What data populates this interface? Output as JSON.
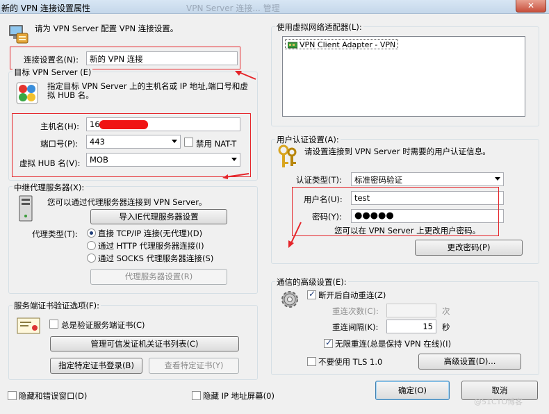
{
  "window": {
    "title": "新的 VPN 连接设置属性",
    "background_title": "VPN Server 连接... 管理",
    "close_label": "✕"
  },
  "header": {
    "intro_text": "请为 VPN Server 配置 VPN 连接设置。"
  },
  "connection": {
    "name_label": "连接设置名(N):",
    "name_value": "新的 VPN 连接"
  },
  "target_server": {
    "group_label": "目标 VPN Server (E)",
    "description": "指定目标 VPN Server 上的主机名或 IP 地址,端口号和虚拟 HUB 名。",
    "host_label": "主机名(H):",
    "host_value": "169",
    "port_label": "端口号(P):",
    "port_value": "443",
    "disable_nat_label": "禁用 NAT-T",
    "hub_label": "虚拟 HUB 名(V):",
    "hub_value": "MOB"
  },
  "proxy": {
    "group_label": "中继代理服务器(X):",
    "description": "您可以通过代理服务器连接到 VPN Server。",
    "import_button": "导入IE代理服务器设置",
    "type_label": "代理类型(T):",
    "options": [
      "直接 TCP/IP 连接(无代理)(D)",
      "通过 HTTP 代理服务器连接(I)",
      "通过 SOCKS 代理服务器连接(S)"
    ],
    "settings_button": "代理服务器设置(R)"
  },
  "cert": {
    "group_label": "服务端证书验证选项(F):",
    "always_verify_label": "总是验证服务端证书(C)",
    "manage_button": "管理可信发证机关证书列表(C)",
    "specify_button": "指定特定证书登录(B)",
    "view_button": "查看特定证书(Y)"
  },
  "footer": {
    "hide_status_label": "隐藏和错误窗口(D)",
    "hide_ip_label": "隐藏 IP 地址屏幕(0)",
    "ok_button": "确定(O)",
    "cancel_button": "取消"
  },
  "adapter": {
    "group_label": "使用虚拟网络适配器(L):",
    "items": [
      "VPN Client Adapter - VPN"
    ]
  },
  "auth": {
    "group_label": "用户认证设置(A):",
    "description": "请设置连接到 VPN Server 时需要的用户认证信息。",
    "type_label": "认证类型(T):",
    "type_value": "标准密码验证",
    "username_label": "用户名(U):",
    "username_value": "test",
    "password_label": "密码(Y):",
    "password_value": "●●●●●",
    "change_hint": "您可以在 VPN Server 上更改用户密码。",
    "change_button": "更改密码(P)"
  },
  "advanced": {
    "group_label": "通信的高级设置(E):",
    "auto_reconnect_label": "断开后自动重连(Z)",
    "retry_count_label": "重连次数(C):",
    "retry_count_unit": "次",
    "retry_interval_label": "重连间隔(K):",
    "retry_interval_value": "15",
    "retry_interval_unit": "秒",
    "infinite_label": "无限重连(总是保持 VPN 在线)(I)",
    "no_tls_label": "不要使用 TLS 1.0",
    "advanced_button": "高级设置(D)..."
  },
  "watermark": "@51CTO博客"
}
